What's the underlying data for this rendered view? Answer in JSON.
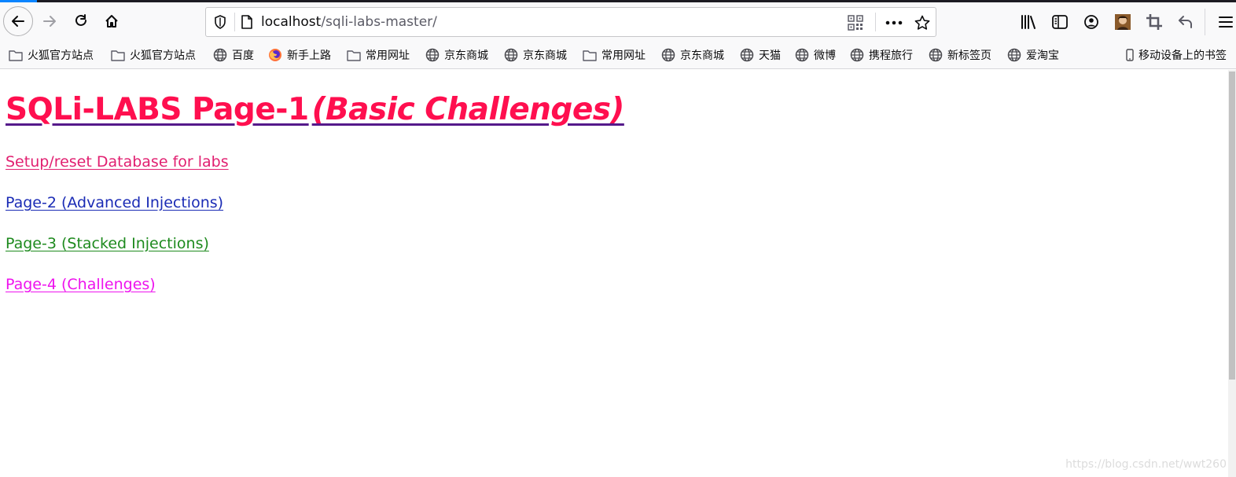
{
  "browser": {
    "url_host": "localhost",
    "url_path": "/sqli-labs-master/",
    "nav_icons": [
      "back-icon",
      "forward-icon",
      "reload-icon",
      "home-icon"
    ],
    "toolbar_icons": [
      "library-icon",
      "sidebar-icon",
      "account-icon",
      "avatar-icon",
      "screenshot-icon",
      "undo-icon",
      "menu-icon"
    ]
  },
  "bookmarks": [
    {
      "label": "火狐官方站点",
      "icon": "folder-icon"
    },
    {
      "label": "火狐官方站点",
      "icon": "folder-icon"
    },
    {
      "label": "百度",
      "icon": "globe-icon"
    },
    {
      "label": "新手上路",
      "icon": "firefox-icon"
    },
    {
      "label": "常用网址",
      "icon": "folder-icon"
    },
    {
      "label": "京东商城",
      "icon": "globe-icon"
    },
    {
      "label": "京东商城",
      "icon": "globe-icon"
    },
    {
      "label": "常用网址",
      "icon": "folder-icon"
    },
    {
      "label": "京东商城",
      "icon": "globe-icon"
    },
    {
      "label": "天猫",
      "icon": "globe-icon"
    },
    {
      "label": "微博",
      "icon": "globe-icon"
    },
    {
      "label": "携程旅行",
      "icon": "globe-icon"
    },
    {
      "label": "新标签页",
      "icon": "globe-icon"
    },
    {
      "label": "爱淘宝",
      "icon": "globe-icon"
    }
  ],
  "mobile_bookmarks": "移动设备上的书签",
  "page": {
    "heading_main": "SQLi-LABS Page-1",
    "heading_sub": "(Basic Challenges)",
    "links": {
      "setup": "Setup/reset Database for labs",
      "page2": "Page-2 (Advanced Injections)",
      "page3": "Page-3 (Stacked Injections)",
      "page4": "Page-4 (Challenges)"
    }
  },
  "watermark": "https://blog.csdn.net/wwt260",
  "colors": {
    "heading": "#ff0f4f",
    "setup_link": "#e11f70",
    "page2_link": "#1a2bb5",
    "page3_link": "#1e8a1e",
    "page4_link": "#ee12ee"
  }
}
